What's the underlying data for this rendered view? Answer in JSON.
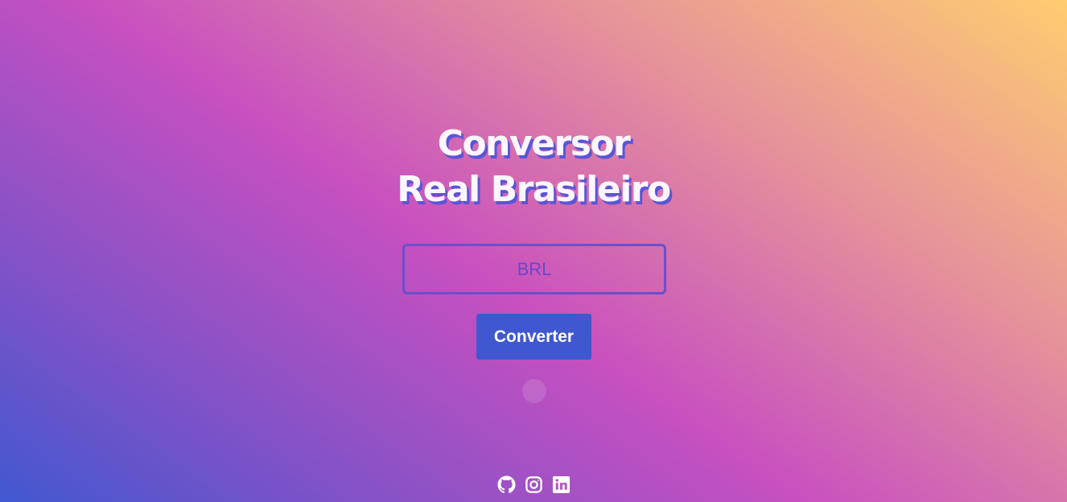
{
  "header": {
    "title_line1": "Conversor",
    "title_line2": "Real Brasileiro"
  },
  "form": {
    "input_placeholder": "BRL",
    "input_value": "",
    "convert_label": "Converter"
  },
  "social": {
    "icons": [
      "github-icon",
      "instagram-icon",
      "linkedin-icon"
    ]
  },
  "colors": {
    "gradient": [
      "#4158d0",
      "#c850c0",
      "#ffcc70"
    ],
    "button": "#4058cf",
    "input_border": "#6c4fc9",
    "title_shadow": "#5a55d6"
  }
}
